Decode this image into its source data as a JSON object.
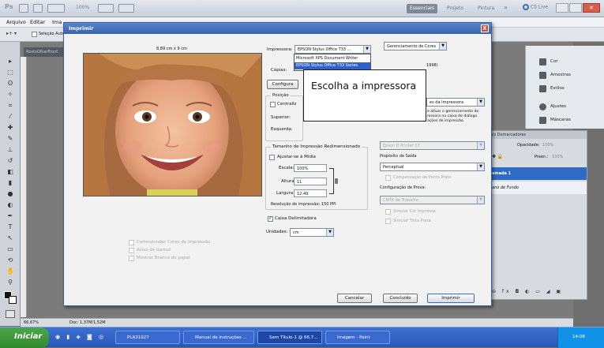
{
  "appbar": {
    "logo": "Ps",
    "zoom_select": "100%",
    "workspaces": [
      "Essenciais",
      "Projeto",
      "Pintura"
    ],
    "more": "»",
    "cs_live": "CS Live"
  },
  "menubar": {
    "items": [
      "Arquivo",
      "Editar",
      "Ima"
    ]
  },
  "options_bar": {
    "item": "Seleção Auto"
  },
  "document": {
    "tab": "RostoOlharFront"
  },
  "status": {
    "zoom": "66,67%",
    "doc": "Doc: 1,37M/1,52M"
  },
  "right_panels": {
    "items": [
      "Cor",
      "Amostras",
      "Estilos",
      "Ajustes",
      "Máscaras"
    ],
    "layers_tabs": "ais   Demarcadores",
    "opacity_label": "Opacidade:",
    "opacity_value": "100%",
    "fill_label": "Preen.:",
    "fill_value": "100%",
    "layer_selected": "amada 1",
    "layer_background": "ano de Fundo"
  },
  "dialog": {
    "title": "Imprimir",
    "close": "X",
    "photo_size": "8,89 cm x 9 cm",
    "printer_label": "Impressora:",
    "printer_value": "EPSON Stylus Office T33 ...",
    "printer_options": [
      "Microsoft XPS Document Writer",
      "EPSON Stylus Office T33 Series"
    ],
    "copies_label": "Cópias:",
    "setup_button": "Configura",
    "position_group": "Posição",
    "center_label": "Centraliz",
    "top_label": "Superior:",
    "left_label": "Esquerda:",
    "scaled_group": "Tamanho de Impressão Redimensionado",
    "fit_media": "Ajustar-se à Mídia",
    "scale_label": "Escala:",
    "scale_value": "100%",
    "height_label": "Altura:",
    "height_value": "11",
    "width_label": "Largura:",
    "width_value": "12,49",
    "resolution": "Resolução de impressão: 150 PPI",
    "bounding_box": "Caixa Delimitadora",
    "units_label": "Unidades:",
    "units_value": "cm",
    "match_colors": "Corresponder Cores de Impressão",
    "gamut_warning": "Aviso de Gamut",
    "show_paper_white": "Mostrar Branco do papel",
    "color_mgmt_select": "Gerenciamento de Cores",
    "document_profile": "1998)",
    "color_handling_value": "es da Impressora",
    "color_note": "e ativar o gerenciamento de\nressora na caixa de diálogo\nações de impressão.",
    "printer_profile": "Epson D Printer 07",
    "render_intent_label": "Propósito de Saída",
    "render_intent_value": "Perceptual",
    "black_point": "Compensação de Ponto Preto",
    "proof_setup_label": "Configuração de Prova:",
    "proof_value": "CMYK de Trabalho",
    "simulate_ink": "Simular Cor Impressa",
    "simulate_paper": "Simular Tinta Preta",
    "cancel_button": "Cancelar",
    "done_button": "Concluído",
    "print_button": "Imprimir"
  },
  "callout": {
    "text": "Escolha a impressora"
  },
  "taskbar": {
    "start": "Iniciar",
    "items": [
      "PLA31027",
      "Manual de instruções ...",
      "Sem Título-1 @ 66,7...",
      "Imagem - Paint"
    ],
    "clock": "14:08"
  }
}
